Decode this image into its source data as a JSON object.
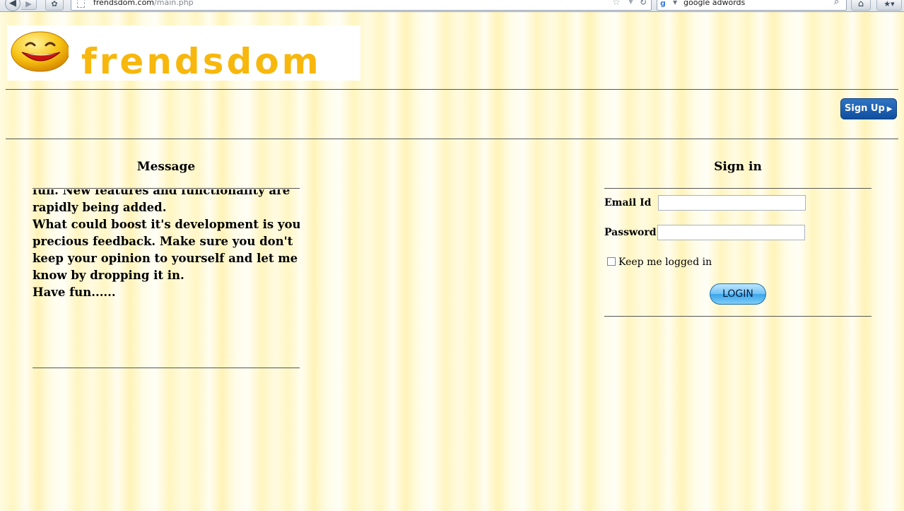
{
  "browser": {
    "url_domain": "frendsdom.com",
    "url_path": "/main.php",
    "search_query": "google adwords"
  },
  "header": {
    "logo_text": "frendsdom",
    "signup_label": "Sign Up"
  },
  "message": {
    "title": "Message",
    "lines": [
      "fun. New features and functionality are",
      "rapidly being added.",
      "What could boost it's development is your",
      "precious feedback. Make sure you don't",
      "keep your opinion to yourself and let me",
      "know by dropping it in.",
      "Have fun......"
    ]
  },
  "signin": {
    "title": "Sign in",
    "email_label": "Email Id",
    "email_value": "",
    "password_label": "Password",
    "password_value": "",
    "keep_logged_in_label": "Keep me logged in",
    "keep_logged_in_checked": false,
    "login_label": "LOGIN"
  }
}
